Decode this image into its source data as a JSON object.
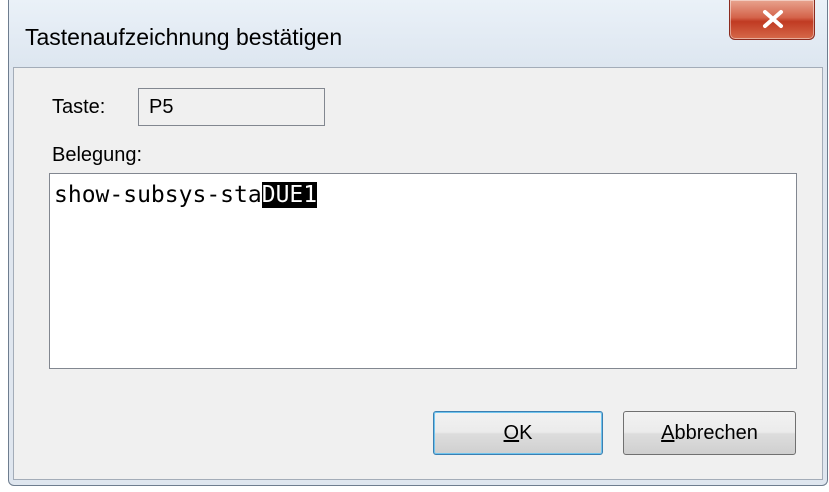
{
  "window": {
    "title": "Tastenaufzeichnung bestätigen"
  },
  "titlebar": {
    "close_icon": "close-x-icon"
  },
  "form": {
    "taste_label": "Taste:",
    "taste_value": "P5",
    "belegung_label": "Belegung:",
    "belegung_text_plain": "show-subsys-sta",
    "belegung_text_selected": "DUE1"
  },
  "buttons": {
    "ok_mnemonic": "O",
    "ok_rest": "K",
    "cancel_mnemonic": "A",
    "cancel_rest": "bbrechen"
  },
  "colors": {
    "close_button": "#c8462c",
    "selection_background": "#000000",
    "selection_text": "#ffffff",
    "default_button_border": "#3c7fb1"
  }
}
